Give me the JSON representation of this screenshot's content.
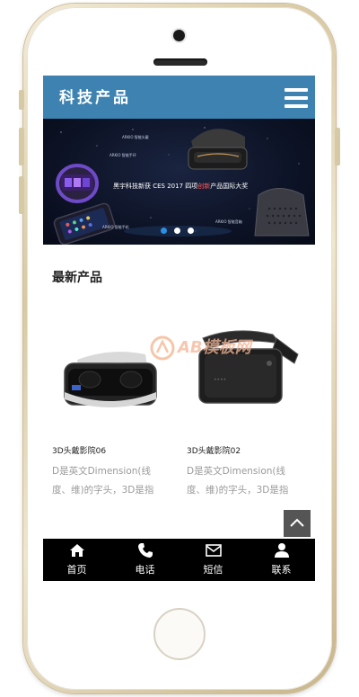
{
  "header": {
    "title": "科技产品"
  },
  "banner": {
    "headline_prefix": "黑宇科技新获 CES 2017 四项",
    "headline_highlight": "创新",
    "headline_suffix": "产品国际大奖",
    "tiny_labels": [
      "ARKIO 智能头戴",
      "ARKIO 智能手环",
      "ARKIO 智能音箱",
      "ARKIO 智能手机"
    ]
  },
  "section": {
    "title": "最新产品"
  },
  "products": [
    {
      "name": "3D头戴影院06",
      "desc": "D是英文Dimension(线度、维)的字头，3D是指"
    },
    {
      "name": "3D头戴影院02",
      "desc": "D是英文Dimension(线度、维)的字头，3D是指"
    }
  ],
  "watermark": {
    "text": "AB模板网"
  },
  "nav": {
    "items": [
      {
        "label": "首页",
        "icon": "home-icon"
      },
      {
        "label": "电话",
        "icon": "phone-icon"
      },
      {
        "label": "短信",
        "icon": "mail-icon"
      },
      {
        "label": "联系",
        "icon": "user-icon"
      }
    ]
  },
  "colors": {
    "header": "#3d82b1",
    "nav": "#000000",
    "dot_active": "#2d8fe0"
  }
}
